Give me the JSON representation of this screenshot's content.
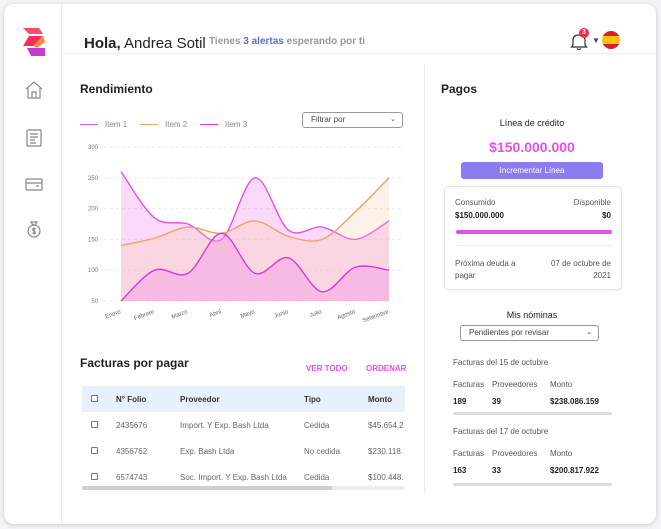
{
  "header": {
    "greeting": "Hola,",
    "user_name": "Andrea Sotil",
    "alerts_prefix": "Tienes",
    "alerts_count": "3 alertas",
    "alerts_suffix": "esperando por ti",
    "notification_count": "3"
  },
  "colors": {
    "accent_pink": "#e452e6",
    "button_purple": "#8a7df0",
    "series_1": "#e452e6",
    "series_2": "#f0a26a",
    "series_3": "#d53bd6"
  },
  "sidebar": {
    "icons": [
      "home-icon",
      "invoice-icon",
      "credit-card-icon",
      "money-bag-icon"
    ]
  },
  "rendimiento": {
    "title": "Rendimiento",
    "filter_label": "Filtrar por",
    "legend": [
      "Item 1",
      "Item 2",
      "Item 3"
    ]
  },
  "chart_data": {
    "type": "area",
    "categories": [
      "Enero",
      "Febrero",
      "Marzo",
      "Abril",
      "Mayo",
      "Junio",
      "Julio",
      "Agosto",
      "Setiembre"
    ],
    "y_ticks": [
      "300",
      "250",
      "200",
      "150",
      "100",
      "50"
    ],
    "ylim": [
      50,
      300
    ],
    "grid": true,
    "legend_position": "top-left",
    "series": [
      {
        "name": "Item 1",
        "values": [
          260,
          185,
          175,
          150,
          250,
          165,
          170,
          150,
          180
        ]
      },
      {
        "name": "Item 2",
        "values": [
          140,
          152,
          170,
          160,
          180,
          155,
          150,
          195,
          250
        ]
      },
      {
        "name": "Item 3",
        "values": [
          50,
          100,
          95,
          160,
          95,
          120,
          65,
          105,
          100
        ]
      }
    ]
  },
  "facturas": {
    "title": "Facturas por pagar",
    "ver_todo": "VER TODO",
    "ordenar": "ORDENAR",
    "columns": [
      "N° Folio",
      "Proveedor",
      "Tipo",
      "Monto"
    ],
    "rows": [
      [
        "2435676",
        "Import. Y Exp. Bash Ltda",
        "Cedida",
        "$45.654.2"
      ],
      [
        "4356762",
        "Exp. Bash Ltda",
        "No cedida",
        "$230.118."
      ],
      [
        "6574743",
        "Soc. Import. Y Exp. Bash Ltda",
        "Cedida",
        "$100.448."
      ]
    ]
  },
  "pagos": {
    "title": "Pagos",
    "credit_label": "Línea de crédito",
    "credit_amount": "$150.000.000",
    "increase_button": "Incrementar Línea",
    "consumido_label": "Consumido",
    "consumido_value": "$150.000.000",
    "disponible_label": "Disponible",
    "disponible_value": "$0",
    "usage_fraction": 1.0,
    "next_debt_label_1": "Próxima deuda a",
    "next_debt_label_2": "pagar",
    "next_debt_date_1": "07 de octubre de",
    "next_debt_date_2": "2021"
  },
  "nominas": {
    "title": "Mis nóminas",
    "filter_selected": "Pendientes por revisar",
    "groups": [
      {
        "title": "Facturas del 15 de octubre",
        "facturas": "189",
        "proveedores": "39",
        "monto": "$238.086.159"
      },
      {
        "title": "Facturas del 17 de octubre",
        "facturas": "163",
        "proveedores": "33",
        "monto": "$200.817.922"
      }
    ],
    "col_facturas": "Facturas",
    "col_proveedores": "Proveedores",
    "col_monto": "Monto"
  }
}
